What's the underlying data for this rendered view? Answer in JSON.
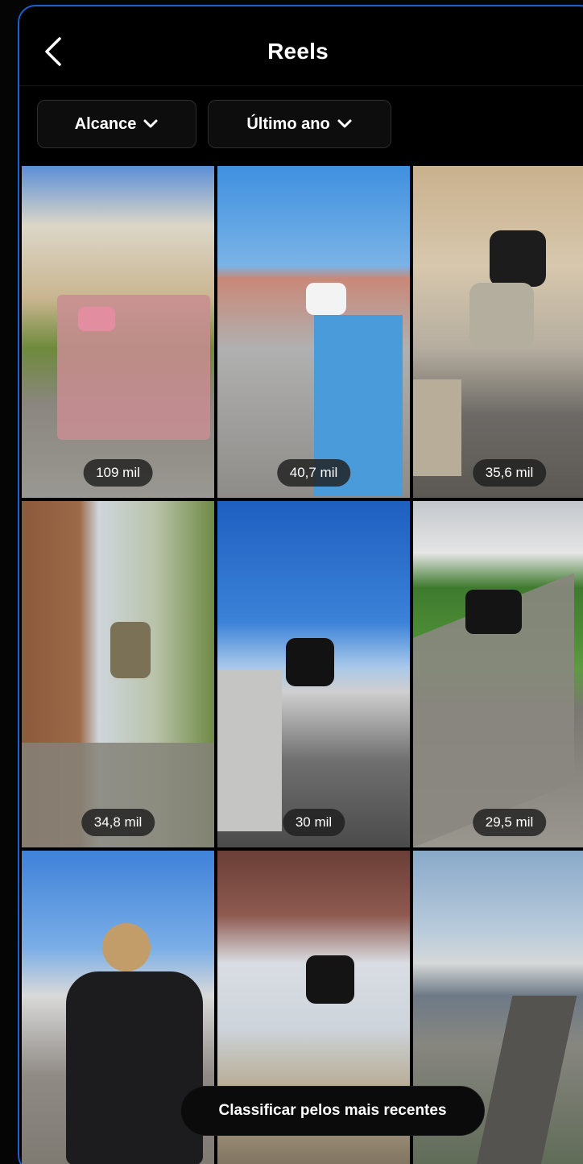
{
  "header": {
    "title": "Reels",
    "back_icon": "chevron-left-icon"
  },
  "filters": [
    {
      "label": "Alcance",
      "icon": "chevron-down-icon"
    },
    {
      "label": "Último ano",
      "icon": "chevron-down-icon"
    }
  ],
  "reels": [
    {
      "views": "109 mil"
    },
    {
      "views": "40,7 mil"
    },
    {
      "views": "35,6 mil"
    },
    {
      "views": "34,8 mil"
    },
    {
      "views": "30 mil"
    },
    {
      "views": "29,5 mil"
    },
    {
      "views": ""
    },
    {
      "views": ""
    },
    {
      "views": ""
    }
  ],
  "sort_button": {
    "label": "Classificar pelos mais recentes"
  },
  "colors": {
    "background": "#000000",
    "frame_border": "#1f5fcf",
    "pill_bg": "#1e1e1e"
  }
}
